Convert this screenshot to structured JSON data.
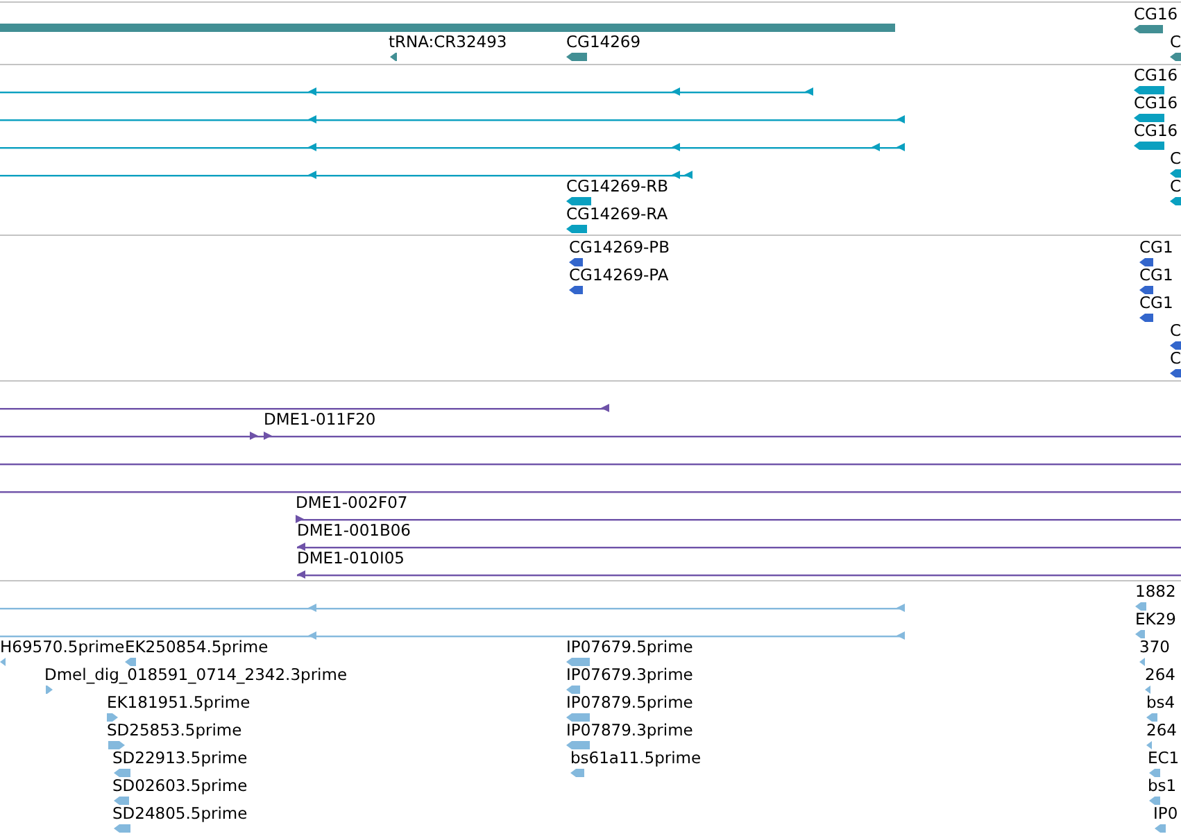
{
  "tracks": [
    {
      "color": "#428f94",
      "features": [
        {
          "kind": "bar"
        },
        {
          "kind": "gene",
          "label": "tRNA:CR32493",
          "reverse": true
        },
        {
          "kind": "gene",
          "label": "CG14269",
          "reverse": true
        },
        {
          "kind": "gene",
          "label": "CG16",
          "reverse": true
        },
        {
          "kind": "gene",
          "label": "C",
          "reverse": true
        }
      ]
    },
    {
      "color": "#0aa0c0",
      "features": [
        {
          "kind": "line",
          "reverse": true
        },
        {
          "kind": "line",
          "reverse": true
        },
        {
          "kind": "line",
          "reverse": true
        },
        {
          "kind": "line",
          "reverse": true
        },
        {
          "kind": "gene",
          "label": "CG14269-RB",
          "reverse": true
        },
        {
          "kind": "gene",
          "label": "CG14269-RA",
          "reverse": true
        },
        {
          "kind": "gene",
          "label": "CG16",
          "reverse": true
        },
        {
          "kind": "gene",
          "label": "CG16",
          "reverse": true
        },
        {
          "kind": "gene",
          "label": "CG16",
          "reverse": true
        },
        {
          "kind": "gene",
          "label": "C",
          "reverse": true
        },
        {
          "kind": "gene",
          "label": "C",
          "reverse": true
        }
      ]
    },
    {
      "color": "#3366cc",
      "features": [
        {
          "kind": "gene",
          "label": "CG14269-PB",
          "reverse": true
        },
        {
          "kind": "gene",
          "label": "CG14269-PA",
          "reverse": true
        },
        {
          "kind": "gene",
          "label": "CG1",
          "reverse": true
        },
        {
          "kind": "gene",
          "label": "CG1",
          "reverse": true
        },
        {
          "kind": "gene",
          "label": "CG1",
          "reverse": true
        },
        {
          "kind": "gene",
          "label": "C",
          "reverse": true
        },
        {
          "kind": "gene",
          "label": "C",
          "reverse": true
        }
      ]
    },
    {
      "color": "#6e52a8",
      "features": [
        {
          "kind": "line",
          "reverse": true
        },
        {
          "kind": "line",
          "label": "DME1-011F20",
          "reverse": false
        },
        {
          "kind": "line"
        },
        {
          "kind": "line"
        },
        {
          "kind": "line",
          "label": "DME1-002F07",
          "reverse": false
        },
        {
          "kind": "line",
          "label": "DME1-001B06",
          "reverse": true
        },
        {
          "kind": "line",
          "label": "DME1-010I05",
          "reverse": true
        }
      ]
    },
    {
      "color": "#84b9dd",
      "features": [
        {
          "kind": "line",
          "reverse": true
        },
        {
          "kind": "line",
          "reverse": true
        },
        {
          "kind": "gene",
          "label": "H69570.5prime",
          "reverse": true
        },
        {
          "kind": "gene",
          "label": "EK250854.5prime",
          "reverse": true
        },
        {
          "kind": "gene",
          "label": "Dmel_dig_018591_0714_2342.3prime",
          "reverse": false
        },
        {
          "kind": "gene",
          "label": "EK181951.5prime",
          "reverse": false
        },
        {
          "kind": "gene",
          "label": "SD25853.5prime",
          "reverse": false
        },
        {
          "kind": "gene",
          "label": "SD22913.5prime",
          "reverse": true
        },
        {
          "kind": "gene",
          "label": "SD02603.5prime",
          "reverse": true
        },
        {
          "kind": "gene",
          "label": "SD24805.5prime",
          "reverse": true
        },
        {
          "kind": "gene",
          "label": "IP07679.5prime",
          "reverse": true
        },
        {
          "kind": "gene",
          "label": "IP07679.3prime",
          "reverse": true
        },
        {
          "kind": "gene",
          "label": "IP07879.5prime",
          "reverse": true
        },
        {
          "kind": "gene",
          "label": "IP07879.3prime",
          "reverse": true
        },
        {
          "kind": "gene",
          "label": "bs61a11.5prime",
          "reverse": true
        },
        {
          "kind": "gene",
          "label": "1882",
          "reverse": true
        },
        {
          "kind": "gene",
          "label": "EK29",
          "reverse": true
        },
        {
          "kind": "gene",
          "label": "370",
          "reverse": true
        },
        {
          "kind": "gene",
          "label": "264",
          "reverse": true
        },
        {
          "kind": "gene",
          "label": "bs4",
          "reverse": true
        },
        {
          "kind": "gene",
          "label": "264",
          "reverse": true
        },
        {
          "kind": "gene",
          "label": "EC1",
          "reverse": true
        },
        {
          "kind": "gene",
          "label": "bs1",
          "reverse": true
        },
        {
          "kind": "gene",
          "label": "IP0",
          "reverse": true
        }
      ]
    }
  ]
}
